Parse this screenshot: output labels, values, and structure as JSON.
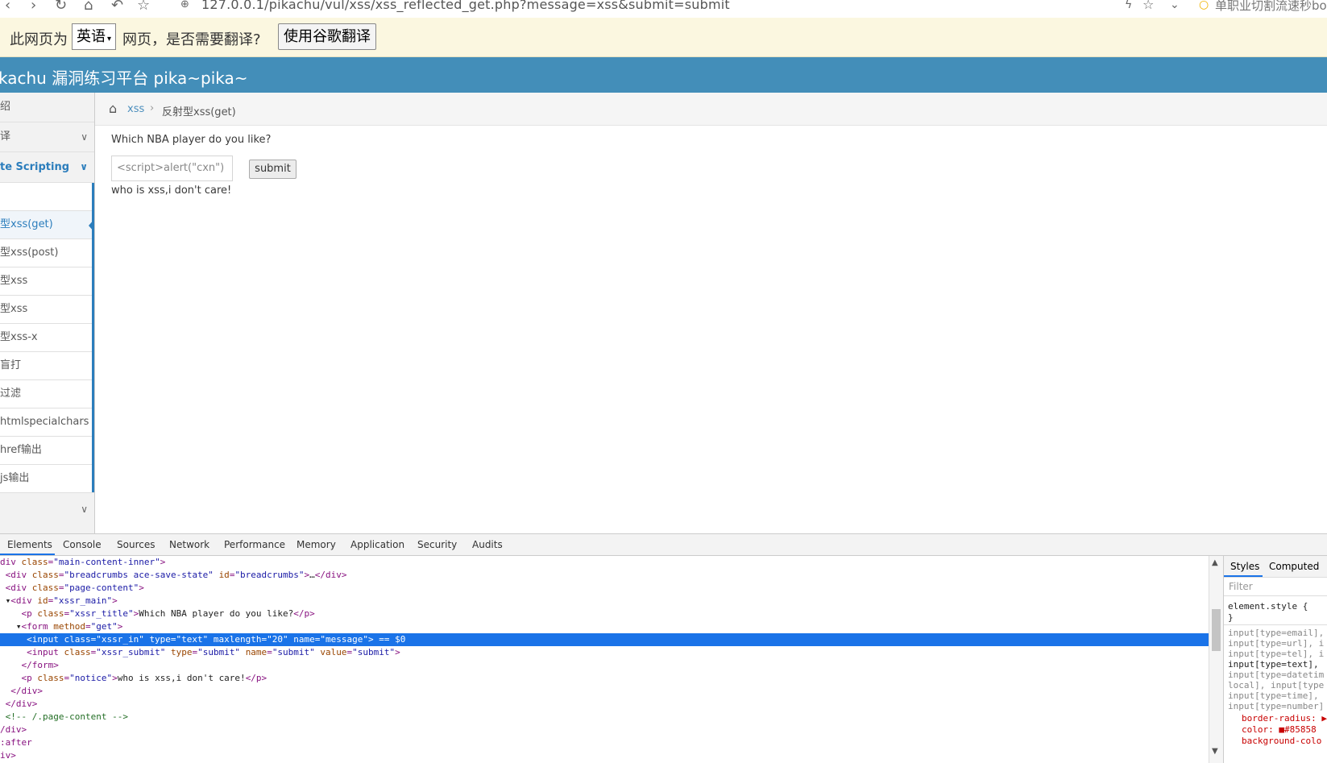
{
  "browser": {
    "url": "127.0.0.1/pikachu/vul/xss/xss_reflected_get.php?message=xss&submit=submit",
    "right_text": "单职业切割流速秒bo"
  },
  "translate_bar": {
    "prompt": "此网页为",
    "language": "英语",
    "suffix": "网页，是否需要翻译?",
    "translate_button": "使用谷歌翻译"
  },
  "site": {
    "title": "kachu 漏洞练习平台 pika~pika~"
  },
  "sidebar": {
    "items": [
      {
        "label": "绍"
      },
      {
        "label": "译"
      },
      {
        "label": "te Scripting"
      },
      {
        "label": ""
      },
      {
        "label": "型xss(get)"
      },
      {
        "label": "型xss(post)"
      },
      {
        "label": "型xss"
      },
      {
        "label": "型xss"
      },
      {
        "label": "型xss-x"
      },
      {
        "label": "盲打"
      },
      {
        "label": "过滤"
      },
      {
        "label": "htmlspecialchars"
      },
      {
        "label": "href输出"
      },
      {
        "label": "js输出"
      }
    ]
  },
  "breadcrumbs": {
    "parent": "xss",
    "current": "反射型xss(get)"
  },
  "main": {
    "question": "Which NBA player do you like?",
    "input_value": "<script>alert(\"cxn\")",
    "submit_label": "submit",
    "notice": "who is xss,i don't care!"
  },
  "devtools": {
    "tabs": [
      "Elements",
      "Console",
      "Sources",
      "Network",
      "Performance",
      "Memory",
      "Application",
      "Security",
      "Audits"
    ],
    "code": {
      "l0_a": "div ",
      "l0_b": "class",
      "l0_c": "\"main-content-inner\"",
      "l1_b": "class",
      "l1_c": "\"breadcrumbs ace-save-state\"",
      "l1_d": "id",
      "l1_e": "\"breadcrumbs\"",
      "l1_f": "…",
      "l2_b": "class",
      "l2_c": "\"page-content\"",
      "l3_b": "id",
      "l3_c": "\"xssr_main\"",
      "l4_b": "class",
      "l4_c": "\"xssr_title\"",
      "l4_t": "Which NBA player do you like?",
      "l5_b": "method",
      "l5_c": "\"get\"",
      "l6": "  <input class=\"xssr_in\" type=\"text\" maxlength=\"20\" name=\"message\"> == $0",
      "l7_c": "\"xssr_submit\"",
      "l7_e": "\"submit\"",
      "l7_g": "\"submit\"",
      "l7_i": "\"submit\"",
      "l9_c": "\"notice\"",
      "l9_t": "who is xss,i don't care!",
      "l12": "<!-- /.page-content -->",
      "l14": ":after"
    },
    "styles_tabs": [
      "Styles",
      "Computed"
    ],
    "filter_placeholder": "Filter",
    "styles_lines": [
      "element.style {",
      "}",
      "input[type=email],",
      "input[type=url], i",
      "input[type=tel], i",
      "input[type=text],",
      "input[type=datetim",
      "local], input[type",
      "input[type=time],",
      "input[type=number]"
    ],
    "style_props": [
      "border-radius: ▶",
      "color: ■#85858",
      "background-colo"
    ]
  },
  "colors": {
    "header": "#438eb9",
    "sidebar_active": "#2b7dbc",
    "selection": "#1a73e8"
  }
}
